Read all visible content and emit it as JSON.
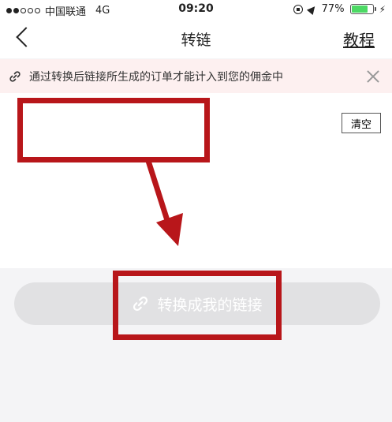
{
  "status_bar": {
    "carrier": "中国联通",
    "network": "4G",
    "time": "09:20",
    "battery": "77%",
    "battery_level": 0.77
  },
  "header": {
    "title": "转链",
    "tutorial_label": "教程"
  },
  "notice": {
    "text": "通过转换后链接所生成的订单才能计入到您的佣金中"
  },
  "input_panel": {
    "clear_label": "清空",
    "value": ""
  },
  "convert_button": {
    "label": "转换成我的链接"
  },
  "colors": {
    "annotation": "#b8161a",
    "notice_bg": "#fdf0f0",
    "battery": "#4cd964",
    "button_disabled": "#e1e1e3"
  }
}
